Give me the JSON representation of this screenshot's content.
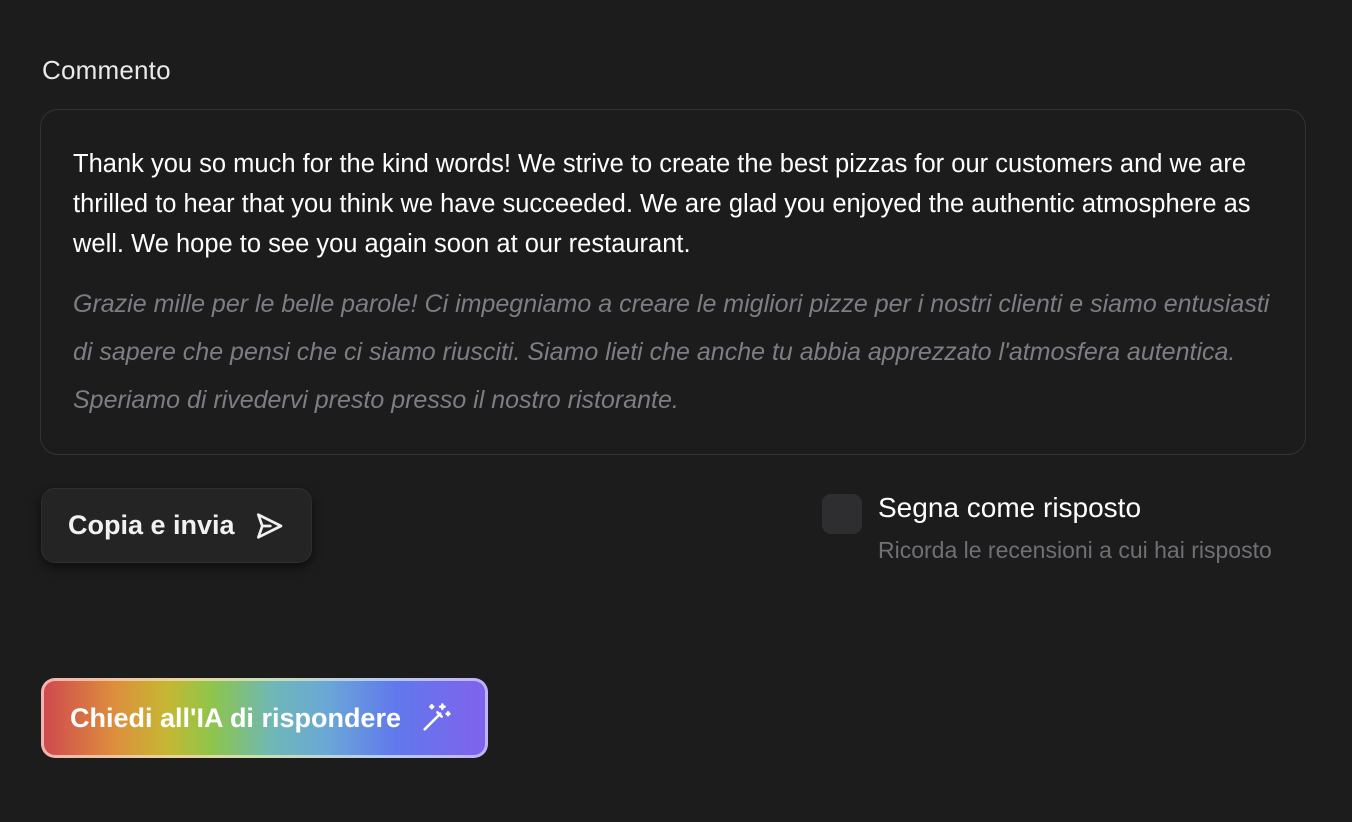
{
  "comment": {
    "label": "Commento",
    "reply_text": "Thank you so much for the kind words! We strive to create the best pizzas for our customers and we are thrilled to hear that you think we have succeeded. We are glad you enjoyed the authentic atmosphere as well. We hope to see you again soon at our restaurant.",
    "translation_text": "Grazie mille per le belle parole! Ci impegniamo a creare le migliori pizze per i nostri clienti e siamo entusiasti di sapere che pensi che ci siamo riusciti. Siamo lieti che anche tu abbia apprezzato l'atmosfera autentica. Speriamo di rivedervi presto presso il nostro ristorante."
  },
  "actions": {
    "copy_send_label": "Copia e invia",
    "copy_send_icon": "send-icon",
    "ai_label": "Chiedi all'IA di rispondere",
    "ai_icon": "magic-wand-icon"
  },
  "answered": {
    "checked": false,
    "title": "Segna come risposto",
    "hint": "Ricorda le recensioni a cui hai risposto"
  },
  "colors": {
    "background": "#1c1c1c",
    "text_primary": "#ffffff",
    "text_muted": "#7d7d85",
    "button_bg": "#242424"
  }
}
